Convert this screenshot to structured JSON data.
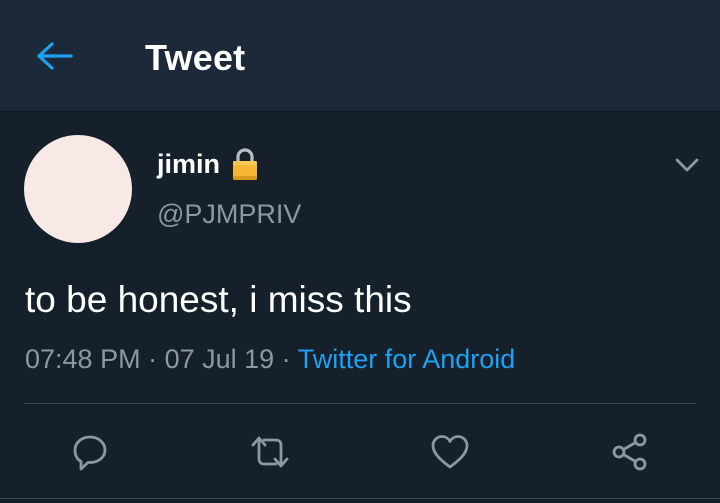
{
  "header": {
    "title": "Tweet",
    "back_icon": "arrow-left-icon",
    "accent_color": "#1da1f2"
  },
  "tweet": {
    "display_name": "jimin",
    "protected_icon": "lock-icon",
    "handle": "@PJMPRIV",
    "text": "to be honest, i miss this",
    "time": "07:48 PM",
    "separator_1": " · ",
    "date": "07 Jul 19",
    "separator_2": " · ",
    "source": "Twitter for Android",
    "avatar_color": "#f9e9e6"
  },
  "actions": [
    {
      "icon": "reply-icon"
    },
    {
      "icon": "retweet-icon"
    },
    {
      "icon": "like-icon"
    },
    {
      "icon": "share-icon"
    }
  ],
  "colors": {
    "background": "#15202b",
    "header_background": "#1c2938",
    "secondary_text": "#8899a6",
    "link": "#1da1f2",
    "divider": "#38444d"
  }
}
